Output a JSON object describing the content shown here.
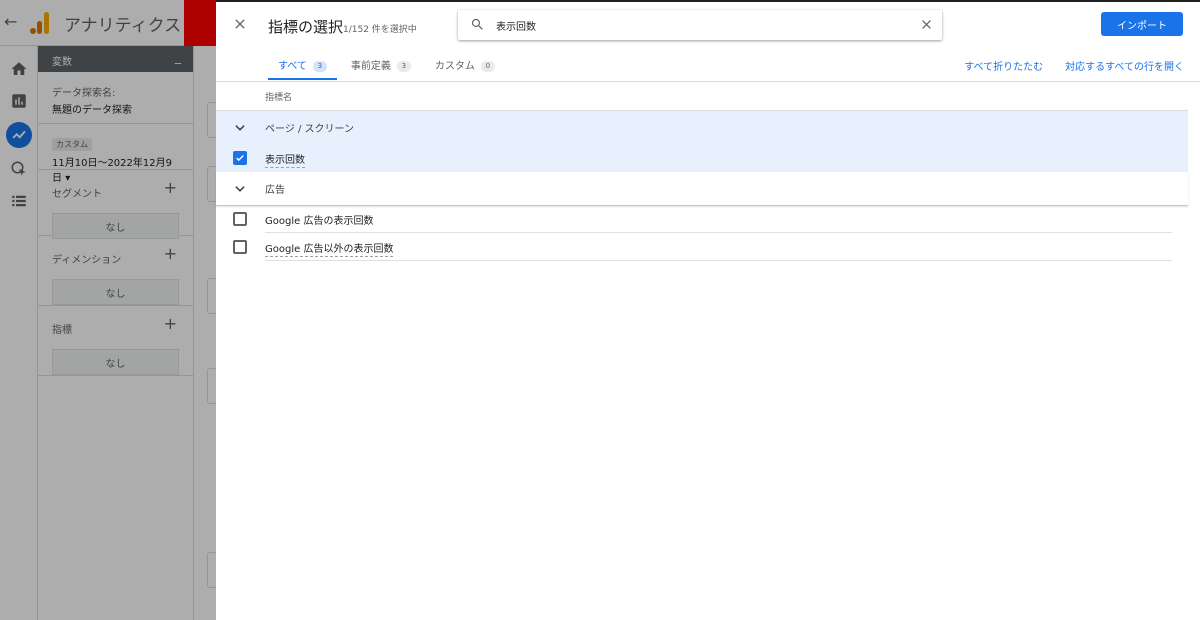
{
  "app": {
    "title": "アナリティクス",
    "back_icon": "arrow-left-icon",
    "nav_icons": [
      "home-icon",
      "reports-icon",
      "explore-icon",
      "advertising-icon",
      "list-icon"
    ]
  },
  "variables_panel": {
    "header": "変数",
    "collapse_symbol": "_",
    "exploration_label": "データ探索名:",
    "exploration_name": "無題のデータ探索",
    "date_chip": "カスタム",
    "date_range": "11月10日～2022年12月9日",
    "segments_label": "セグメント",
    "segments_value": "なし",
    "dimensions_label": "ディメンション",
    "dimensions_value": "なし",
    "metrics_label": "指標",
    "metrics_value": "なし",
    "add_symbol": "+"
  },
  "dialog": {
    "title": "指標の選択",
    "selected_count": "1/152 件を選択中",
    "search": {
      "value": "表示回数",
      "placeholder": ""
    },
    "import_label": "インポート",
    "tabs": [
      {
        "label": "すべて",
        "count": "3"
      },
      {
        "label": "事前定義",
        "count": "3"
      },
      {
        "label": "カスタム",
        "count": "0"
      }
    ],
    "collapse_all_label": "すべて折りたたむ",
    "expand_all_label": "対応するすべての行を開く",
    "column_header": "指標名",
    "groups": [
      {
        "label": "ページ / スクリーン",
        "items": [
          {
            "label": "表示回数",
            "checked": true
          }
        ]
      },
      {
        "label": "広告",
        "items": [
          {
            "label": "Google 広告の表示回数",
            "checked": false
          },
          {
            "label": "Google 広告以外の表示回数",
            "checked": false
          }
        ]
      }
    ]
  },
  "colors": {
    "accent": "#1a73e8",
    "selected_row": "#e8f0fe",
    "red_block": "#ff0000"
  }
}
